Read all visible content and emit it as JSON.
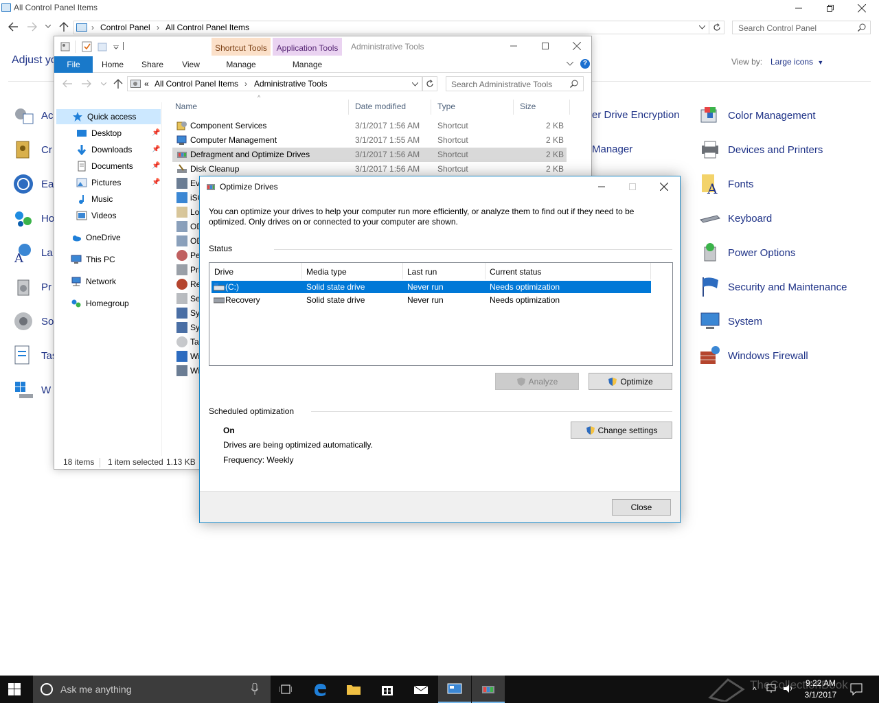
{
  "control_panel": {
    "title": "All Control Panel Items",
    "breadcrumb": [
      "Control Panel",
      "All Control Panel Items"
    ],
    "search_placeholder": "Search Control Panel",
    "heading": "Adjust yo",
    "view_by_label": "View by:",
    "view_by_value": "Large icons",
    "left_column_partial": [
      "Ac",
      "Cr",
      "Ea",
      "Ho",
      "La",
      "Pr",
      "So",
      "Tas",
      "W"
    ],
    "mid_column_partial": [
      "er Drive Encryption",
      "Manager"
    ],
    "right_column": [
      "Color Management",
      "Devices and Printers",
      "Fonts",
      "Keyboard",
      "Power Options",
      "Security and Maintenance",
      "System",
      "Windows Firewall"
    ]
  },
  "explorer": {
    "title": "Administrative Tools",
    "ctx_shortcut_tools": "Shortcut Tools",
    "ctx_application_tools": "Application Tools",
    "tabs": [
      "File",
      "Home",
      "Share",
      "View",
      "Manage",
      "Manage"
    ],
    "address_prefix": "«",
    "breadcrumb": [
      "All Control Panel Items",
      "Administrative Tools"
    ],
    "search_placeholder": "Search Administrative Tools",
    "nav": [
      "Quick access",
      "Desktop",
      "Downloads",
      "Documents",
      "Pictures",
      "Music",
      "Videos",
      "OneDrive",
      "This PC",
      "Network",
      "Homegroup"
    ],
    "columns": [
      "Name",
      "Date modified",
      "Type",
      "Size"
    ],
    "files": [
      {
        "name": "Component Services",
        "date": "3/1/2017 1:56 AM",
        "type": "Shortcut",
        "size": "2 KB"
      },
      {
        "name": "Computer Management",
        "date": "3/1/2017 1:55 AM",
        "type": "Shortcut",
        "size": "2 KB"
      },
      {
        "name": "Defragment and Optimize Drives",
        "date": "3/1/2017 1:56 AM",
        "type": "Shortcut",
        "size": "2 KB"
      },
      {
        "name": "Disk Cleanup",
        "date": "3/1/2017 1:56 AM",
        "type": "Shortcut",
        "size": "2 KB"
      }
    ],
    "partial_rows": [
      "Eve",
      "iSC",
      "Lo",
      "OD",
      "OD",
      "Pe",
      "Pri",
      "Re",
      "Se",
      "Sys",
      "Sys",
      "Tas",
      "Wi",
      "Wi"
    ],
    "status_items": "18 items",
    "status_selected": "1 item selected",
    "status_size": "1.13 KB"
  },
  "dialog": {
    "title": "Optimize Drives",
    "intro": "You can optimize your drives to help your computer run more efficiently, or analyze them to find out if they need to be optimized. Only drives on or connected to your computer are shown.",
    "status_label": "Status",
    "columns": [
      "Drive",
      "Media type",
      "Last run",
      "Current status"
    ],
    "drives": [
      {
        "drive": "(C:)",
        "media": "Solid state drive",
        "last_run": "Never run",
        "status": "Needs optimization"
      },
      {
        "drive": "Recovery",
        "media": "Solid state drive",
        "last_run": "Never run",
        "status": "Needs optimization"
      }
    ],
    "analyze_label": "Analyze",
    "optimize_label": "Optimize",
    "scheduled_label": "Scheduled optimization",
    "scheduled_state": "On",
    "scheduled_desc": "Drives are being optimized automatically.",
    "frequency": "Frequency: Weekly",
    "change_settings_label": "Change settings",
    "close_label": "Close"
  },
  "taskbar": {
    "search_placeholder": "Ask me anything",
    "time": "9:22 AM",
    "date": "3/1/2017",
    "watermark": "TheCollectionBook"
  }
}
